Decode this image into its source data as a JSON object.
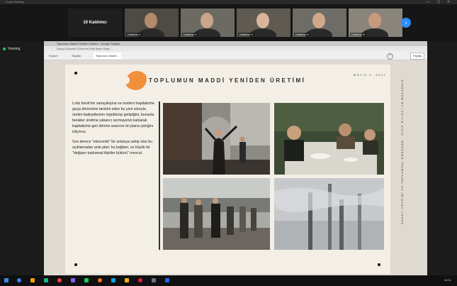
{
  "app": {
    "title": "Zoom Meeting"
  },
  "participants_strip": {
    "speaker_tile_label": "10 Katılımcı",
    "tiles": [
      {
        "name": "Katılımcı 1",
        "bg": "#4e4a44",
        "face": "#b48a6a"
      },
      {
        "name": "Katılımcı 2",
        "bg": "#6b6a63",
        "face": "#c9a58a"
      },
      {
        "name": "Katılımcı 3",
        "bg": "#5f5a52",
        "face": "#d8b49a"
      },
      {
        "name": "Katılımcı 4",
        "bg": "#6e6c66",
        "face": "#d2a88a"
      },
      {
        "name": "Katılımcı 5",
        "bg": "#8a857c",
        "face": "#c79a7d"
      }
    ],
    "next_icon": "chevron-right-icon"
  },
  "viewing_label": "Viewing",
  "browser": {
    "title_bar": "Toplumun Maddi Yeniden Üretimi - Google Slaytlar",
    "menu": "Dosya  Düzenle  Görünüm  Ekle  Biçim  Slayt",
    "tabs": [
      "Sunum",
      "Slaytlar",
      "Toplumun Maddi..."
    ],
    "share_label": "Paylaş",
    "help_label": "?"
  },
  "slide": {
    "title": "TOPLUMUN MADDİ YENİDEN ÜRETİMİ",
    "date": "MAYIS 2, 2021",
    "paragraph1": "Lodz Kenti'nin sanayileşme ve modern kapitalizme geçiş dönemine tanıklık eden bu yeni süreçte, üretim faaliyetlerinin örgütlenişi geliştiğini, bununla beraber üretime yabancı sermayenin katılarak kapitalizme geri dönme arasının ön plana çıktığını izliyoruz.",
    "paragraph2": "Son derece \"ekonomik\" bir anlatıya sahip olan bu açıklamadan anla plan: bu bağlam, ve büyük bir \"değişen toplumsal ilişkiler bütünü\" mevcut.",
    "vertical_text": "SANAYİ DEVRİMİ VE TOPLUMSAL DÖNÜŞÜM · SINIF BİLİNCİ VE MÜCADELE"
  },
  "taskbar": {
    "clock": "16:01",
    "icon_colors": [
      "#3b82f6",
      "#f59e0b",
      "#10b981",
      "#ef4444",
      "#8b5cf6",
      "#22c55e",
      "#f97316",
      "#0ea5e9",
      "#eab308",
      "#e11d48",
      "#64748b",
      "#2563eb"
    ]
  }
}
